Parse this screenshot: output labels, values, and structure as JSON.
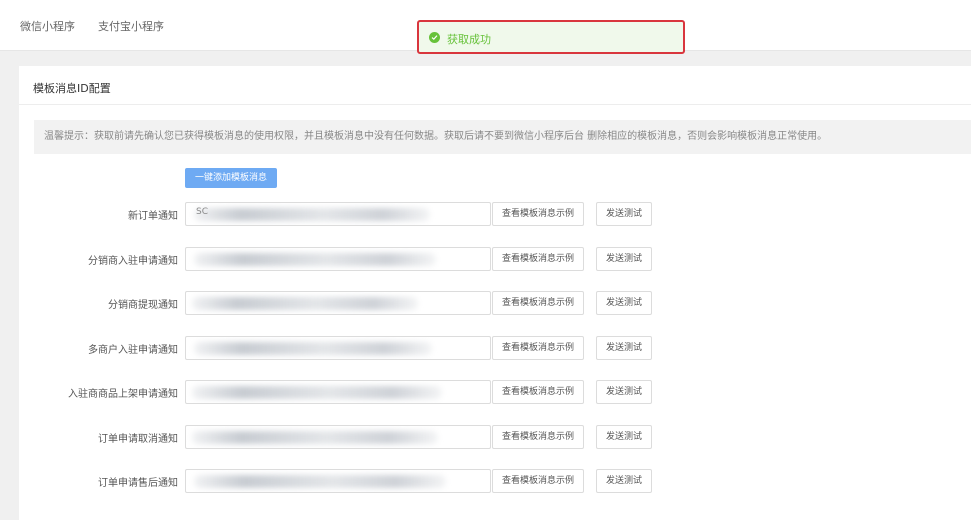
{
  "tabs": [
    "微信小程序",
    "支付宝小程序"
  ],
  "toast": {
    "message": "获取成功",
    "color": "#67c23a",
    "border": "#d9363e"
  },
  "card": {
    "title": "模板消息ID配置",
    "tips": "温馨提示：获取前请先确认您已获得模板消息的使用权限，并且模板消息中没有任何数据。获取后请不要到微信小程序后台 删除相应的模板消息，否则会影响模板消息正常使用。",
    "add_button": "一键添加模板消息"
  },
  "row_buttons": {
    "view": "查看模板消息示例",
    "test": "发送测试"
  },
  "rows": [
    {
      "label": "新订单通知",
      "value": "SC"
    },
    {
      "label": "分销商入驻申请通知",
      "value": ""
    },
    {
      "label": "分销商提现通知",
      "value": ""
    },
    {
      "label": "多商户入驻申请通知",
      "value": ""
    },
    {
      "label": "入驻商商品上架申请通知",
      "value": ""
    },
    {
      "label": "订单申请取消通知",
      "value": ""
    },
    {
      "label": "订单申请售后通知",
      "value": ""
    }
  ]
}
